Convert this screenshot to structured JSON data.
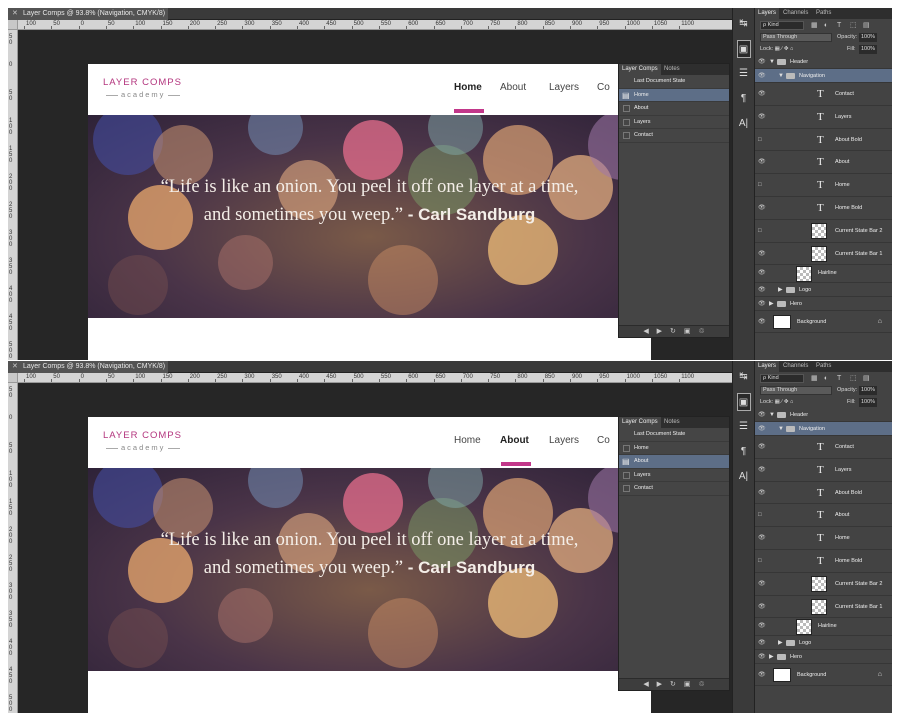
{
  "window": {
    "tab_title": "Layer Comps @ 93.8% (Navigation, CMYK/8) *"
  },
  "ruler": {
    "h_ticks": [
      "100",
      "50",
      "0",
      "50",
      "100",
      "150",
      "200",
      "250",
      "300",
      "350",
      "400",
      "450",
      "500",
      "550",
      "600",
      "650",
      "700",
      "750",
      "800",
      "850",
      "900",
      "950",
      "1000",
      "1050",
      "1100"
    ],
    "v_ticks": [
      "50",
      "0",
      "50",
      "100",
      "150",
      "200",
      "250",
      "300",
      "350",
      "400",
      "450",
      "500"
    ]
  },
  "site": {
    "brand": "LAYER COMPS",
    "brand_sub": "academy",
    "nav": [
      "Home",
      "About",
      "Layers",
      "Co"
    ],
    "quote": "“Life is like an onion. You peel it off one layer at a time, and sometimes you weep.”",
    "author": "- Carl Sandburg"
  },
  "comps_panel": {
    "tabs": [
      "Layer Comps",
      "Notes"
    ],
    "items": [
      "Last Document State",
      "Home",
      "About",
      "Layers",
      "Contact"
    ],
    "footer_icons": [
      "◀",
      "▶",
      "↻",
      "▣",
      "♲"
    ]
  },
  "layers_panel": {
    "tabs": [
      "Layers",
      "Channels",
      "Paths"
    ],
    "kind": "ρ Kind",
    "blend": "Pass Through",
    "opacity_label": "Opacity:",
    "opacity": "100%",
    "lock_label": "Lock:",
    "fill_label": "Fill:",
    "fill": "100%",
    "layers": [
      {
        "name": "Header",
        "type": "group",
        "indent": 0,
        "open": true
      },
      {
        "name": "Navigation",
        "type": "group",
        "indent": 1,
        "open": true,
        "selected": true
      },
      {
        "name": "Contact",
        "type": "text",
        "indent": 2
      },
      {
        "name": "Layers",
        "type": "text",
        "indent": 2
      },
      {
        "name": "About Bold",
        "type": "text",
        "indent": 2
      },
      {
        "name": "About",
        "type": "text",
        "indent": 2
      },
      {
        "name": "Home",
        "type": "text",
        "indent": 2
      },
      {
        "name": "Home Bold",
        "type": "text",
        "indent": 2
      },
      {
        "name": "Current State Bar 2",
        "type": "pixel",
        "indent": 2
      },
      {
        "name": "Current State Bar 1",
        "type": "pixel",
        "indent": 2
      },
      {
        "name": "Hairline",
        "type": "pixel",
        "indent": 1
      },
      {
        "name": "Logo",
        "type": "group",
        "indent": 1,
        "open": false
      },
      {
        "name": "Hero",
        "type": "group",
        "indent": 0,
        "open": false
      },
      {
        "name": "Background",
        "type": "bg",
        "indent": 0
      }
    ]
  },
  "shots": [
    {
      "active_nav": 0,
      "active_comp": 1,
      "visible": [
        1,
        1,
        1,
        1,
        0,
        1,
        0,
        1,
        0,
        1,
        1,
        1,
        1,
        1
      ]
    },
    {
      "active_nav": 1,
      "active_comp": 2,
      "visible": [
        1,
        1,
        1,
        1,
        1,
        0,
        1,
        0,
        1,
        1,
        1,
        1,
        1,
        1
      ]
    }
  ],
  "colors": {
    "brand": "#b3357e",
    "bar": "#c2378a",
    "selection": "#5d6e87"
  }
}
